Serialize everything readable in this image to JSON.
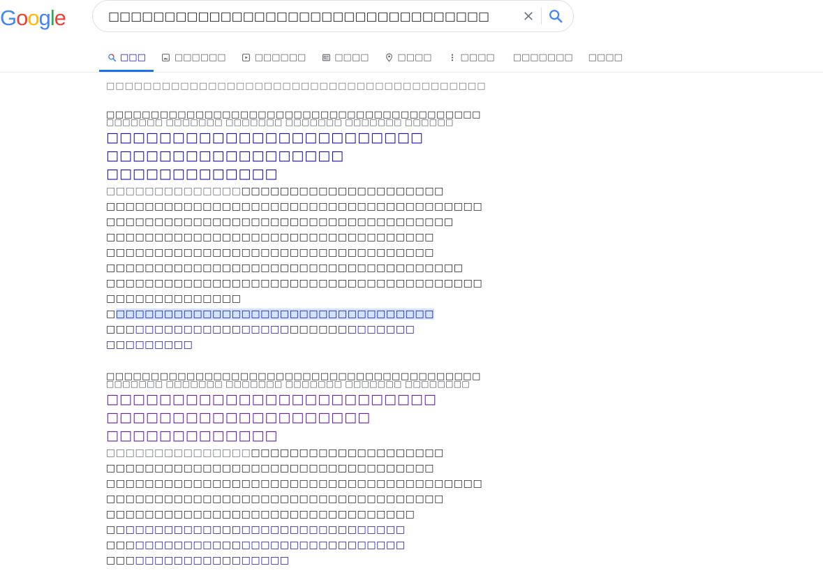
{
  "logo": {
    "text": "Google",
    "letters": [
      {
        "ch": "G",
        "color": "#4285f4"
      },
      {
        "ch": "o",
        "color": "#ea4335"
      },
      {
        "ch": "o",
        "color": "#fbbc05"
      },
      {
        "ch": "g",
        "color": "#4285f4"
      },
      {
        "ch": "l",
        "color": "#34a853"
      },
      {
        "ch": "e",
        "color": "#ea4335"
      }
    ]
  },
  "search": {
    "value": "□□□□□□□□□□□□□□□□□□□□□□□□□□□□□□□□□□"
  },
  "tabs": [
    {
      "label": "□□□",
      "icon": "search-icon",
      "active": true
    },
    {
      "label": "□□□□□□",
      "icon": "image-icon",
      "active": false
    },
    {
      "label": "□□□□□□",
      "icon": "video-icon",
      "active": false
    },
    {
      "label": "□□□□",
      "icon": "news-icon",
      "active": false
    },
    {
      "label": "□□□□",
      "icon": "map-pin-icon",
      "active": false
    },
    {
      "label": "□□□□",
      "icon": "more-icon",
      "active": false
    },
    {
      "label": "□□□□□□□",
      "icon": "",
      "active": false
    },
    {
      "label": "□□□□",
      "icon": "",
      "active": false
    }
  ],
  "stats": "□□□□□□□□□□□□□□□□□□□□□□□□□□□□□□□□□□□□□□□□□",
  "results": [
    {
      "crumb": "□□□□□□□□□□□□□□□□□□□□□□□□□□□□□□□□□□□□□□□□□□",
      "url_overlay": "□□□□□□□ □□□□□□□ □□□□□□□ □□□□□□□ □□□□□□□ □□□□□□",
      "title_lines": [
        "□□□□□□□□□□□□□□□□□□□□□□□□",
        "□□□□□□□□□□□□□□□□□□",
        "□□□□□□□□□□□□□"
      ],
      "date": "□□□□□□□□□□□□□□",
      "snippet_lines": [
        "□□□□□□□□□□□□□□□□□□□□□",
        "□□□□□□□□□□□□□□□□□□□□□□□□□□□□□□□□□□□□□□□",
        "□□□□□□□□□□□□□□□□□□□□□□□□□□□□□□□□□□□□",
        "□□□□□□□□□□□□□□□□□□□□□□□□□□□□□□□□□□",
        "□□□□□□□□□□□□□□□□□□□□□□□□□□□□□□□□□□",
        "□□□□□□□□□□□□□□□□□□□□□□□□□□□□□□□□□□□□□",
        "□□□□□□□□□□□□□□□□□□□□□□□□□□□□□□□□□□□□□□□",
        "□□□□□□□□□□□□□□"
      ],
      "sitelinks": [
        {
          "prefix": "□",
          "link": "□□□□□□□□□□□□□□□□□□□□□□□□□□□□□□□□□",
          "highlight": true
        },
        {
          "prefix": "□□□",
          "link": "□□□□□□□□□□□□□□□□",
          "mid": "□□□□□",
          "link2": "□□□□□□□□"
        },
        {
          "prefix": "",
          "link": "□□□□□□□□□"
        }
      ],
      "visited": false
    },
    {
      "crumb": "□□□□□□□□□□□□□□□□□□□□□□□□□□□□□□□□□□□□□□□□□□",
      "url_overlay": "□□□□□□□ □□□□□□□ □□□□□□□ □□□□□□□ □□□□□□□ □□□□□□□□",
      "title_lines": [
        "□□□□□□□□□□□□□□□□□□□□□□□□□",
        "□□□□□□□□□□□□□□□□□□□□",
        "□□□□□□□□□□□□□"
      ],
      "date": "□□□□□□□□□□□□□□□",
      "snippet_lines": [
        "□□□□□□□□□□□□□□□□□□□□",
        "□□□□□□□□□□□□□□□□□□□□□□□□□□□□□□□□□□",
        "□□□□□□□□□□□□□□□□□□□□□□□□□□□□□□□□□□□□□□□",
        "□□□□□□□□□□□□□□□□□□□□□□□□□□□□□□□□□□□",
        "□□□□□□□□□□□□□□□□□□□□□□□□□□□□□□□□"
      ],
      "sitelinks": [
        {
          "prefix": "□",
          "link": "□□□□□□□□□□□□□□□□□□□□□□□□□□□□□□",
          "highlight": false
        },
        {
          "prefix": "□□□",
          "link": "□□□□□□□□□□□□□□□□□□□□□□□□□□□□"
        },
        {
          "prefix": "□□□",
          "link": "□□□□□□□□□□□□□□□□"
        }
      ],
      "visited": true
    }
  ]
}
